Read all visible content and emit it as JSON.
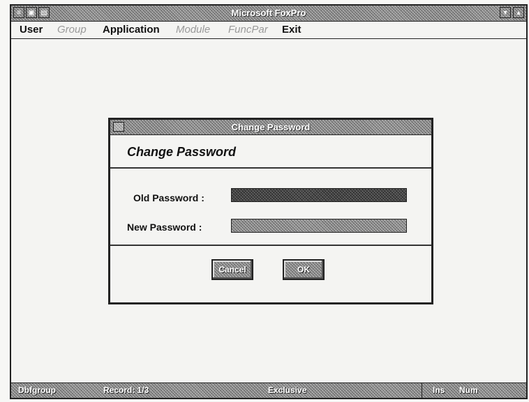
{
  "window": {
    "title": "Microsoft FoxPro"
  },
  "menu": {
    "items": [
      {
        "label": "User",
        "enabled": true
      },
      {
        "label": "Group",
        "enabled": false
      },
      {
        "label": "Application",
        "enabled": true
      },
      {
        "label": "Module",
        "enabled": false
      },
      {
        "label": "FuncPar",
        "enabled": false
      },
      {
        "label": "Exit",
        "enabled": true
      }
    ]
  },
  "dialog": {
    "title": "Change Password",
    "heading": "Change Password",
    "old_password_label": "Old Password :",
    "new_password_label": "New Password :",
    "old_password_value": "",
    "new_password_value": "",
    "cancel_label": "Cancel",
    "ok_label": "OK"
  },
  "status": {
    "table": "Dbfgroup",
    "record": "Record: 1/3",
    "mode": "Exclusive",
    "ins": "Ins",
    "num": "Num"
  }
}
